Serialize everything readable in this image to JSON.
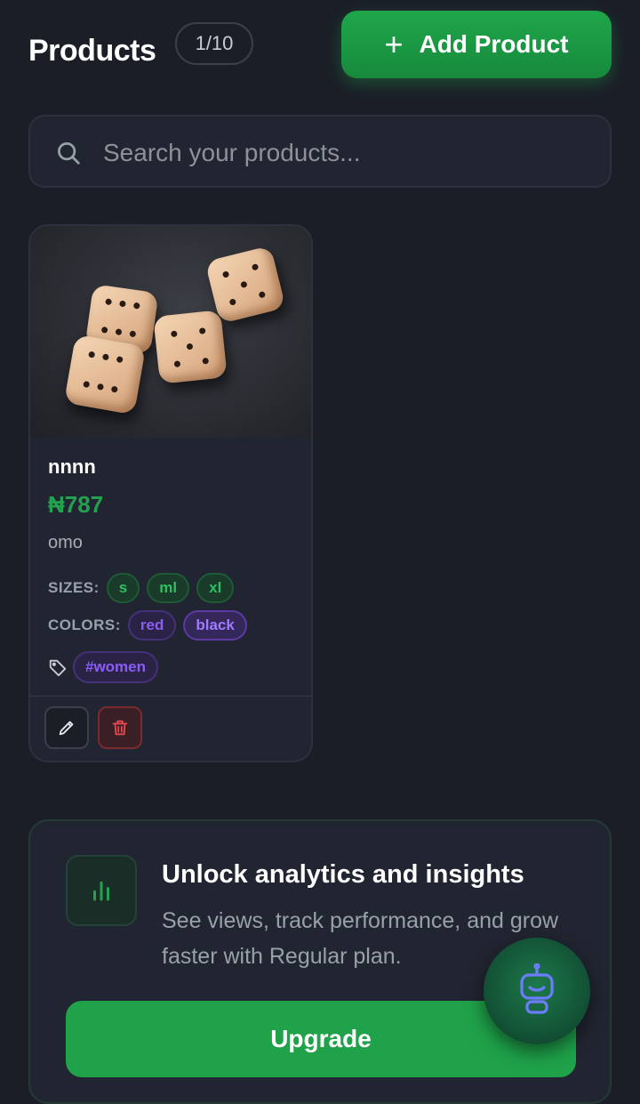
{
  "header": {
    "title": "Products",
    "count_badge": "1/10",
    "add_button_label": "Add Product"
  },
  "search": {
    "placeholder": "Search your products..."
  },
  "products": [
    {
      "name": "nnnn",
      "price": "₦787",
      "description": "omo",
      "sizes_label": "SIZES:",
      "sizes": [
        "s",
        "ml",
        "xl"
      ],
      "colors_label": "COLORS:",
      "colors": [
        "red",
        "black"
      ],
      "tags": [
        "#women"
      ]
    }
  ],
  "upsell": {
    "title": "Unlock analytics and insights",
    "text": "See views, track performance, and grow faster with Regular plan.",
    "button_label": "Upgrade"
  },
  "icons": {
    "search": "search-icon",
    "add": "plus-icon",
    "tag": "tag-icon",
    "edit": "pencil-icon",
    "delete": "trash-icon",
    "analytics": "bar-chart-icon",
    "assistant": "robot-icon"
  },
  "colors": {
    "background": "#1b1e27",
    "accent_green": "#1fa24a",
    "price_green": "#22a24f",
    "tag_purple": "#8b5cf6",
    "delete_red": "#e5484d"
  }
}
